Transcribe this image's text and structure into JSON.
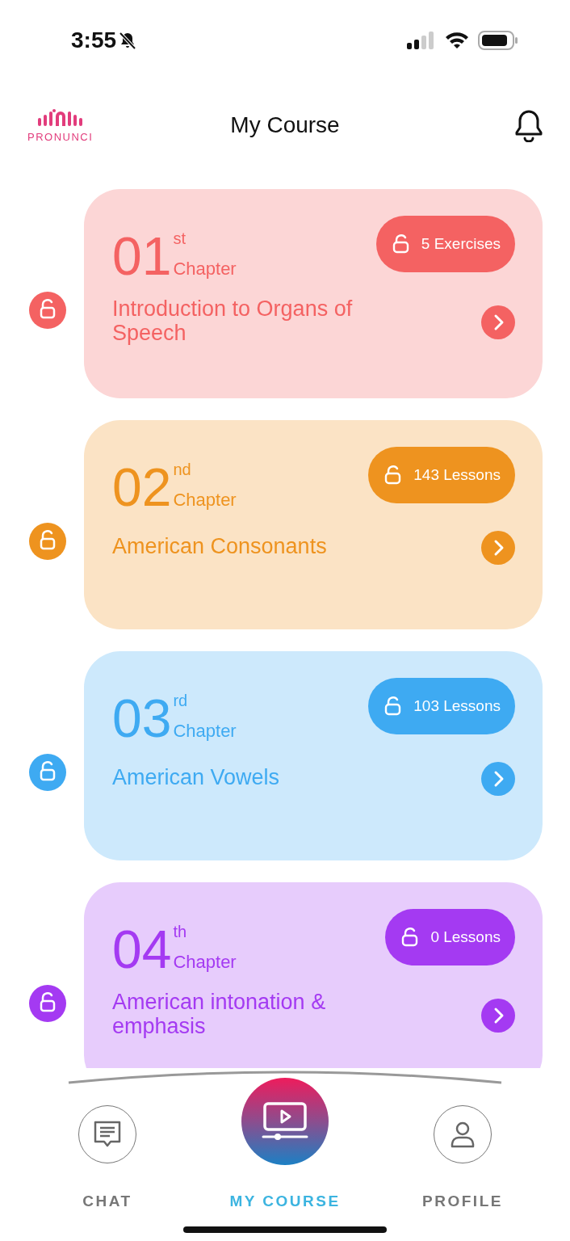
{
  "status_bar": {
    "time": "3:55"
  },
  "header": {
    "logo_text": "PRONUNCI",
    "title": "My Course"
  },
  "chapters": [
    {
      "number": "01",
      "suffix": "st",
      "label": "Chapter",
      "count": "5 Exercises",
      "title": "Introduction to Organs of Speech",
      "color": "#f46262"
    },
    {
      "number": "02",
      "suffix": "nd",
      "label": "Chapter",
      "count": "143 Lessons",
      "title": "American Consonants",
      "color": "#ee931f"
    },
    {
      "number": "03",
      "suffix": "rd",
      "label": "Chapter",
      "count": "103 Lessons",
      "title": "American Vowels",
      "color": "#3eaaf2"
    },
    {
      "number": "04",
      "suffix": "th",
      "label": "Chapter",
      "count": "0 Lessons",
      "title": "American intonation & emphasis",
      "color": "#a43af2"
    }
  ],
  "nav": [
    {
      "label": "CHAT",
      "selected": false
    },
    {
      "label": "MY COURSE",
      "selected": true
    },
    {
      "label": "PROFILE",
      "selected": false
    }
  ]
}
